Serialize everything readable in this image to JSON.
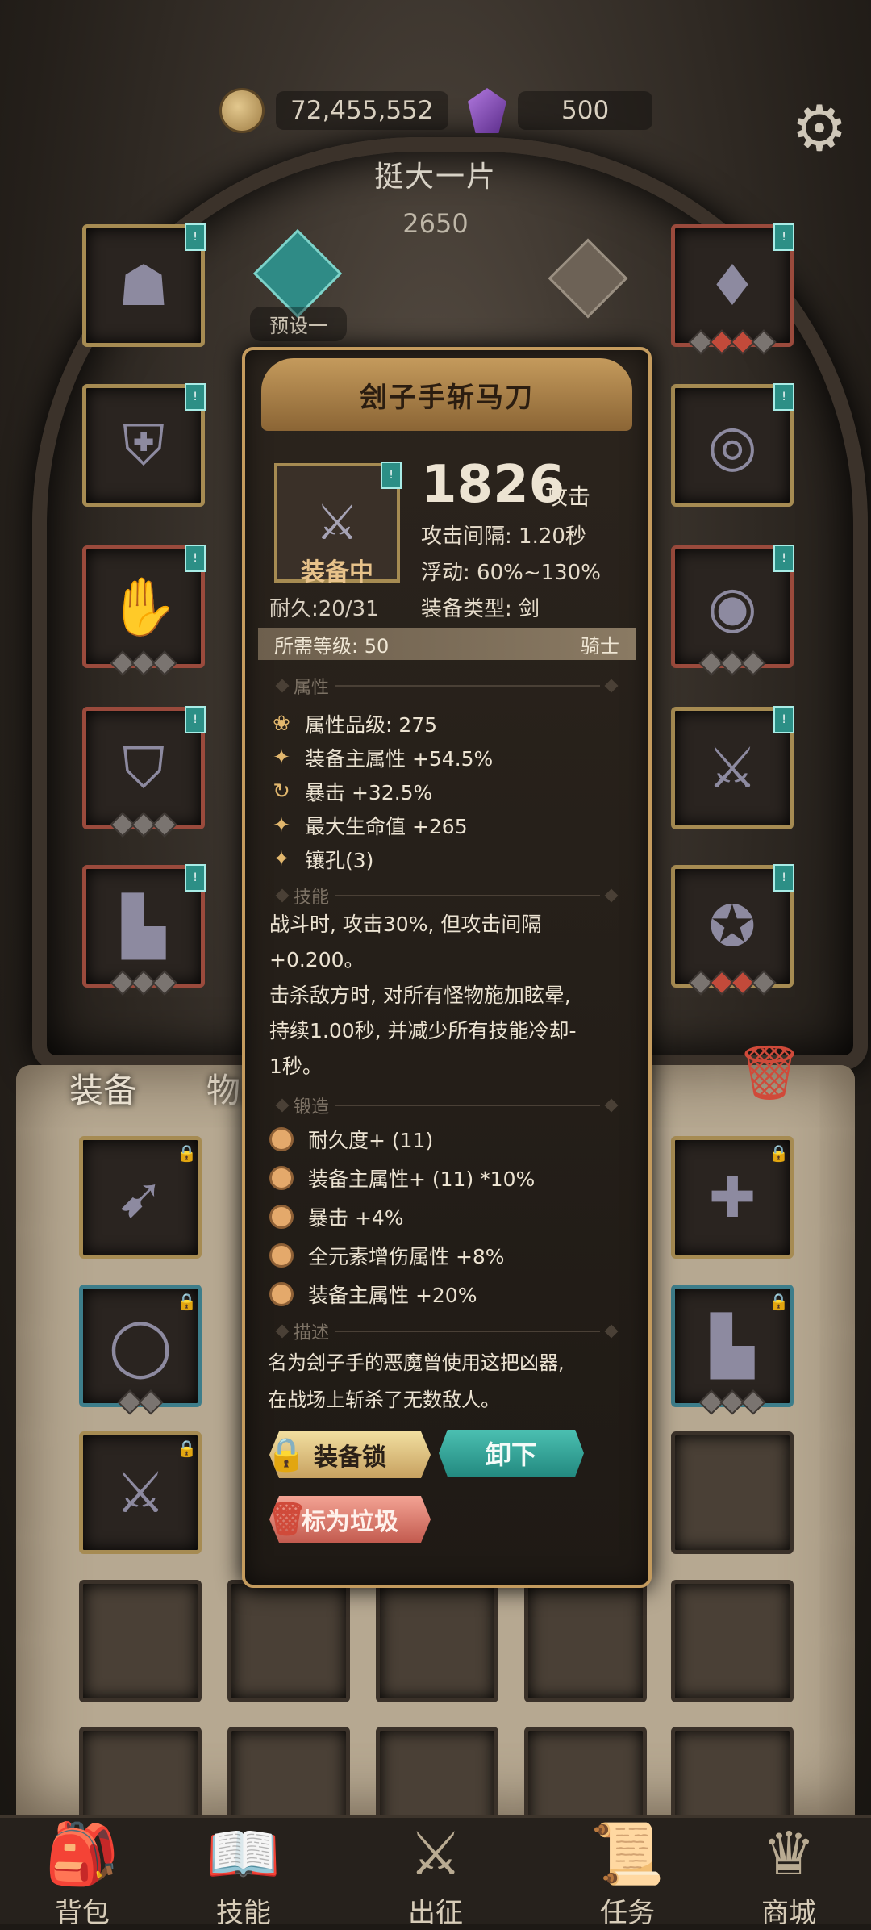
{
  "currency": {
    "gold": "72,455,552",
    "gems": "500"
  },
  "profile": {
    "name": "挺大一片",
    "score": "2650",
    "preset_label": "预设一"
  },
  "tabs": {
    "equipment": "装备",
    "items": "物品"
  },
  "item": {
    "name": "刽子手斩马刀",
    "equipped_label": "装备中",
    "durability": "耐久:20/31",
    "attack_value": "1826",
    "attack_unit": "攻击",
    "attack_interval": "攻击间隔: 1.20秒",
    "float": "浮动: 60%~130%",
    "type": "装备类型: 剑",
    "required_level": "所需等级: 50",
    "class": "骑士",
    "sections": {
      "attributes": "属性",
      "skills": "技能",
      "forge": "锻造",
      "description": "描述"
    },
    "attributes": [
      {
        "icon": "lotus-icon",
        "text": "属性品级: 275"
      },
      {
        "icon": "sparkle-icon",
        "text": "装备主属性 +54.5%"
      },
      {
        "icon": "cycle-icon",
        "text": "暴击 +32.5%"
      },
      {
        "icon": "sparkle-icon",
        "text": "最大生命值 +265"
      },
      {
        "icon": "sparkle-icon",
        "text": "镶孔(3)"
      }
    ],
    "skill_text": [
      "战斗时, 攻击30%, 但攻击间隔",
      "+0.200。",
      "击杀敌方时, 对所有怪物施加眩晕,",
      "持续1.00秒, 并减少所有技能冷却-",
      "1秒。"
    ],
    "forge": [
      "耐久度+ (11)",
      "装备主属性+ (11) *10%",
      "暴击 +4%",
      "全元素增伤属性 +8%",
      "装备主属性 +20%"
    ],
    "description": [
      "名为刽子手的恶魔曾使用这把凶器,",
      "在战场上斩杀了无数敌人。"
    ],
    "buttons": {
      "lock": "装备锁",
      "unequip": "卸下",
      "junk": "标为垃圾"
    }
  },
  "nav": [
    {
      "label": "背包",
      "icon": "backpack-icon"
    },
    {
      "label": "技能",
      "icon": "skill-book-icon"
    },
    {
      "label": "出征",
      "icon": "sword-icon"
    },
    {
      "label": "任务",
      "icon": "scroll-icon"
    },
    {
      "label": "商城",
      "icon": "shop-icon"
    }
  ]
}
